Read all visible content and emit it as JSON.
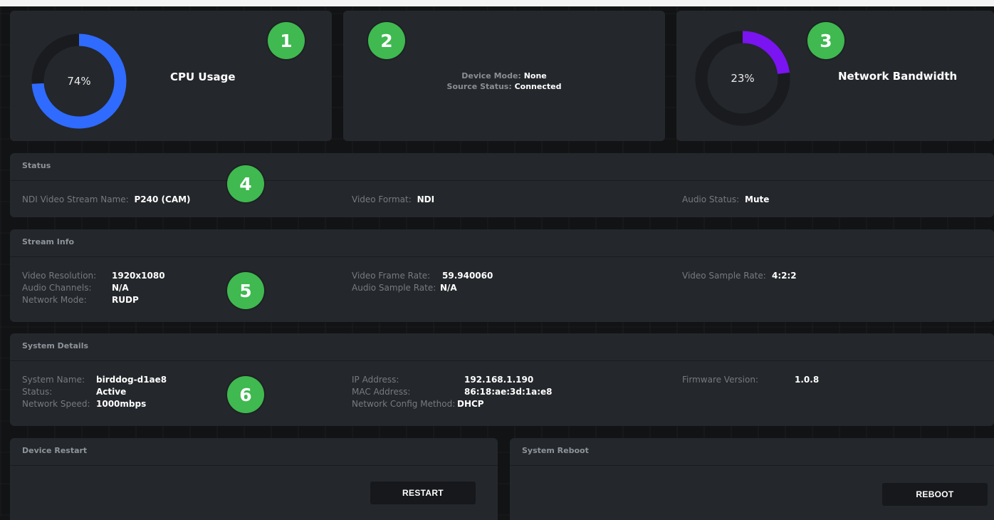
{
  "cpu": {
    "percent_text": "74%",
    "percent": 74,
    "label": "CPU Usage",
    "color": "#2f6bff"
  },
  "device": {
    "mode_label": "Device Mode:",
    "mode_value": "None",
    "source_label": "Source Status:",
    "source_value": "Connected"
  },
  "network": {
    "percent_text": "23%",
    "percent": 23,
    "label": "Network Bandwidth",
    "color": "#7a14f0"
  },
  "badges": [
    "1",
    "2",
    "3",
    "4",
    "5",
    "6"
  ],
  "status": {
    "title": "Status",
    "stream_name_label": "NDI Video Stream Name:",
    "stream_name_value": "P240 (CAM)",
    "video_format_label": "Video Format:",
    "video_format_value": "NDI",
    "audio_status_label": "Audio Status:",
    "audio_status_value": "Mute"
  },
  "stream_info": {
    "title": "Stream Info",
    "col1": [
      {
        "label": "Video Resolution:",
        "value": "1920x1080"
      },
      {
        "label": "Audio Channels:",
        "value": "N/A"
      },
      {
        "label": "Network Mode:",
        "value": "RUDP"
      }
    ],
    "col2": [
      {
        "label": "Video Frame Rate:",
        "value": "59.940060"
      },
      {
        "label": "Audio Sample Rate:",
        "value": "N/A"
      }
    ],
    "col3": [
      {
        "label": "Video Sample Rate:",
        "value": "4:2:2"
      }
    ]
  },
  "system_details": {
    "title": "System Details",
    "col1": [
      {
        "label": "System Name:",
        "value": "birddog-d1ae8"
      },
      {
        "label": "Status:",
        "value": "Active"
      },
      {
        "label": "Network Speed:",
        "value": "1000mbps"
      }
    ],
    "col2": [
      {
        "label": "IP Address:",
        "value": "192.168.1.190"
      },
      {
        "label": "MAC Address:",
        "value": "86:18:ae:3d:1a:e8"
      },
      {
        "label": "Network Config Method:",
        "value": "DHCP"
      }
    ],
    "col3": [
      {
        "label": "Firmware Version:",
        "value": "1.0.8"
      }
    ]
  },
  "device_restart": {
    "title": "Device Restart",
    "button": "RESTART"
  },
  "system_reboot": {
    "title": "System Reboot",
    "button": "REBOOT"
  },
  "colors": {
    "badge": "#3fb950",
    "card": "#24272b",
    "ring_track": "#191b1e"
  }
}
